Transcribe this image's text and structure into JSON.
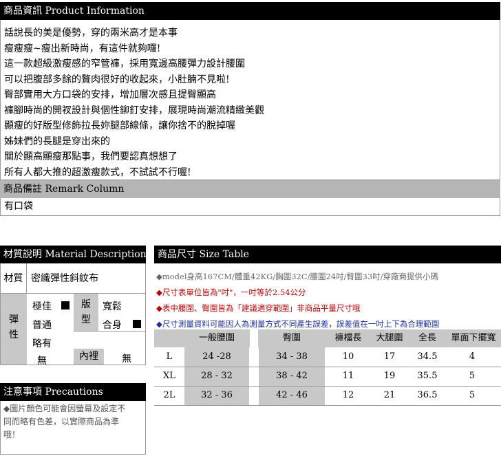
{
  "colors": {
    "header_bg": "#000000",
    "gray_header": "#b5b5b5",
    "note_gray": "#666666",
    "note_red": "#c00000",
    "note_blue": "#1a2ea0",
    "band_gray": "#c8c8c8"
  },
  "product": {
    "title": "商品資訊 Product Information",
    "lines": [
      "話說長的美是優勢，穿的兩米高才是本事",
      "瘦瘦瘦~瘦出新時尚，有這件就夠囉!",
      "這一款超級激瘦感的窄管褲，採用寬邊高腰彈力設計腰圍",
      "可以把腹部多餘的贅肉很好的收起來，小肚腩不見啦!",
      "臀部實用大方口袋的安排，增加層次感且提臀顯高",
      "褲腳時尚的開衩設計與個性鉚釘安排，展現時尚潮流精緻美觀",
      "顯瘦的好版型修飾拉長妳腿部線條，讓你捨不的脫掉喔",
      "姊妹們的長腿是穿出來的",
      "關於顯高顯瘦那點事，我們要認真想想了",
      "所有人都大推的超激瘦款式，不試試不行喔!"
    ]
  },
  "remark": {
    "title": "商品備註 Remark Column",
    "text": "有口袋"
  },
  "material": {
    "title": "材質說明 Material Description",
    "label": "材質",
    "value": "密纖彈性斜紋布",
    "elastic_label": "彈性",
    "elastic_options": [
      "極佳",
      "普通",
      "略有",
      "無"
    ],
    "elastic_selected": "極佳",
    "fit_label": "版型",
    "fit_options": [
      "寬鬆",
      "合身"
    ],
    "fit_selected": "合身",
    "lining_label": "內裡",
    "lining_value": "無"
  },
  "precautions": {
    "title": "注意事項 Precautions",
    "lines": [
      "◆圖片顏色可能會因螢幕及設定不",
      "同而略有色差，以實際商品為準",
      "哦！"
    ]
  },
  "size": {
    "title": "商品尺寸 Size Table",
    "notes": [
      {
        "text": "◆model身高167CM/體重42KG/胸圍32C/腰圍24吋/臀圍33吋/穿廠商提供小碼",
        "color": "#666666"
      },
      {
        "text": "◆尺寸表單位皆為\"吋\"，一吋等於2.54公分",
        "color": "#c00000"
      },
      {
        "text": "◆表中腰圍、臀圍皆為「建議適穿範圍」非商品平量尺寸哦",
        "color": "#c00000"
      },
      {
        "text": "◆尺寸測量資料可能因人為測量方式不同產生誤差，誤差值在一吋上下為合理範圍",
        "color": "#1a2ea0"
      }
    ],
    "headers": [
      "一般腰圍",
      "臀圍",
      "褲檔長",
      "大腿圍",
      "全長",
      "單面下擺寬"
    ],
    "rows": [
      {
        "size": "L",
        "waist": "24 -28",
        "hip": "34 - 38",
        "rise": "10",
        "thigh": "17",
        "length": "34.5",
        "hem": "4"
      },
      {
        "size": "XL",
        "waist": "28 - 32",
        "hip": "38 - 42",
        "rise": "11",
        "thigh": "19",
        "length": "35.5",
        "hem": "5"
      },
      {
        "size": "2L",
        "waist": "32 - 36",
        "hip": "42 - 46",
        "rise": "12",
        "thigh": "21",
        "length": "36.5",
        "hem": "5"
      }
    ]
  }
}
